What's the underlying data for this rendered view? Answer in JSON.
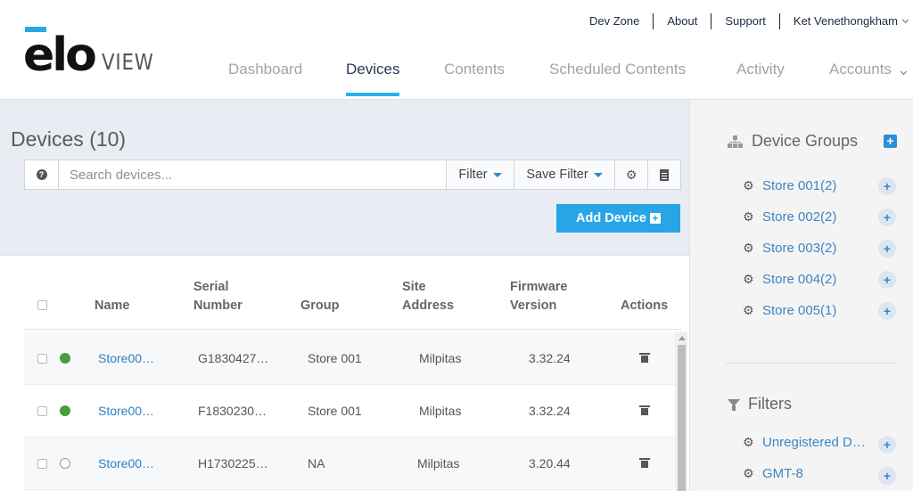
{
  "brand": {
    "logo_main": "elo",
    "logo_sub": "VIEW",
    "accent": "#29a9e0"
  },
  "top_links": {
    "dev_zone": "Dev Zone",
    "about": "About",
    "support": "Support",
    "user": "Ket Venethongkham"
  },
  "nav": {
    "dashboard": "Dashboard",
    "devices": "Devices",
    "contents": "Contents",
    "scheduled": "Scheduled Contents",
    "activity": "Activity",
    "accounts": "Accounts",
    "active": "Devices"
  },
  "page": {
    "title": "Devices (10)"
  },
  "search": {
    "placeholder": "Search devices...",
    "filter_label": "Filter",
    "save_filter_label": "Save Filter"
  },
  "add_device": {
    "label": "Add Device"
  },
  "table": {
    "headers": {
      "name": "Name",
      "serial_1": "Serial",
      "serial_2": "Number",
      "group": "Group",
      "site_1": "Site",
      "site_2": "Address",
      "firmware_1": "Firmware",
      "firmware_2": "Version",
      "actions": "Actions"
    },
    "rows": [
      {
        "name": "Store00…",
        "serial": "G1830427…",
        "group": "Store 001",
        "site": "Milpitas",
        "firmware": "3.32.24",
        "status": "online"
      },
      {
        "name": "Store00…",
        "serial": "F1830230…",
        "group": "Store 001",
        "site": "Milpitas",
        "firmware": "3.32.24",
        "status": "online"
      },
      {
        "name": "Store00…",
        "serial": "H1730225…",
        "group": "NA",
        "site": "Milpitas",
        "firmware": "3.20.44",
        "status": "offline"
      }
    ]
  },
  "sidebar": {
    "device_groups_title": "Device Groups",
    "groups": [
      {
        "label": "Store 001(2)"
      },
      {
        "label": "Store 002(2)"
      },
      {
        "label": "Store 003(2)"
      },
      {
        "label": "Store 004(2)"
      },
      {
        "label": "Store 005(1)"
      }
    ],
    "filters_title": "Filters",
    "filters": [
      {
        "label": "Unregistered D…"
      },
      {
        "label": "GMT-8"
      }
    ]
  }
}
